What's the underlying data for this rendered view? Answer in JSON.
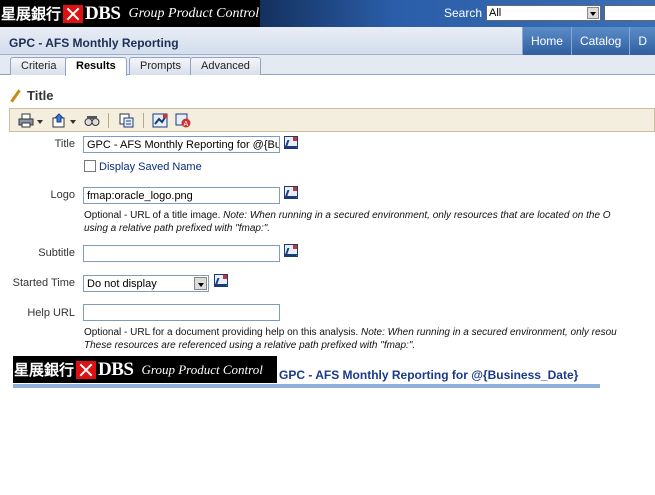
{
  "brand": {
    "cn": "星展銀行",
    "dbs": "DBS",
    "gpc": "Group Product Control"
  },
  "search": {
    "label": "Search",
    "scope": "All"
  },
  "header": {
    "report_title": "GPC - AFS Monthly Reporting",
    "nav": [
      "Home",
      "Catalog",
      "D"
    ]
  },
  "tabs": [
    "Criteria",
    "Results",
    "Prompts",
    "Advanced"
  ],
  "section": {
    "title": "Title"
  },
  "toolbar": {
    "icons": [
      "print-icon",
      "export-icon",
      "preview-icon",
      "properties-icon",
      "format-icon",
      "format-text-icon"
    ]
  },
  "form": {
    "title_label": "Title",
    "title_value": "GPC - AFS Monthly Reporting for @{Business_Date}",
    "display_saved_name": "Display Saved Name",
    "logo_label": "Logo",
    "logo_value": "fmap:oracle_logo.png",
    "logo_help_1": "Optional - URL of a title image. ",
    "logo_help_note_1": "Note: When running in a secured environment, only resources that are located on the O",
    "logo_help_note_2": "using a relative path prefixed with \"fmap:\".",
    "subtitle_label": "Subtitle",
    "subtitle_value": "",
    "started_label": "Started Time",
    "started_value": "Do not display",
    "help_label": "Help URL",
    "help_value": "",
    "help_help_1": "Optional - URL for a document providing help on this analysis. ",
    "help_help_note_1": "Note: When running in a secured environment, only resou",
    "help_help_note_2": "These resources are referenced using a relative path prefixed with \"fmap:\"."
  },
  "preview": {
    "title": "GPC - AFS Monthly Reporting for @{Business_Date}"
  }
}
